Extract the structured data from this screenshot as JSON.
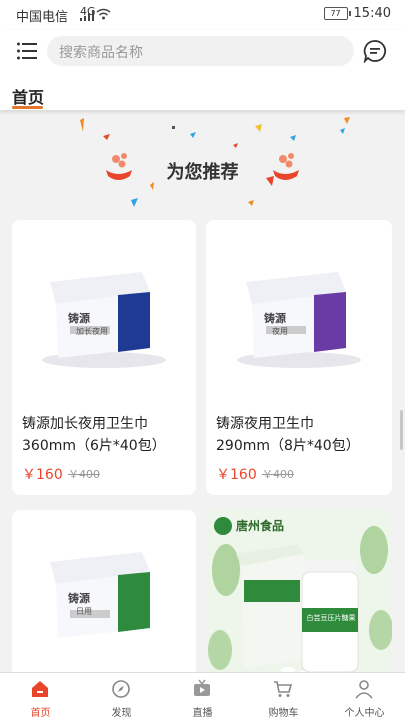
{
  "status_bar": {
    "carrier": "中国电信",
    "network": "4G",
    "battery": "77",
    "time": "15:40"
  },
  "header": {
    "search_placeholder": "搜索商品名称",
    "tab_home": "首页"
  },
  "section": {
    "title": "为您推荐"
  },
  "products": [
    {
      "name_line1": "铸源加长夜用卫生巾",
      "name_line2": "360mm（6片*40包）",
      "price": "￥160",
      "old_price": "￥400",
      "pack_brand": "铸源",
      "pack_label": "加长夜用",
      "accent": "#1f3a93"
    },
    {
      "name_line1": "铸源夜用卫生巾",
      "name_line2": "290mm（8片*40包）",
      "price": "￥160",
      "old_price": "￥400",
      "pack_brand": "铸源",
      "pack_label": "夜用",
      "accent": "#6a3aa5"
    },
    {
      "pack_brand": "铸源",
      "pack_label": "日用",
      "accent": "#2e8b3d"
    },
    {
      "logo_text": "唐州食品",
      "bottle_label": "白芸豆压片糖果",
      "accent": "#2f8a3b"
    }
  ],
  "tabbar": {
    "items": [
      {
        "label": "首页",
        "icon": "home-icon",
        "active": true
      },
      {
        "label": "发现",
        "icon": "compass-icon"
      },
      {
        "label": "直播",
        "icon": "tv-icon"
      },
      {
        "label": "购物车",
        "icon": "cart-icon"
      },
      {
        "label": "个人中心",
        "icon": "user-icon"
      }
    ]
  },
  "colors": {
    "accent": "#e8452b",
    "tab_underline": "#e3762a"
  }
}
